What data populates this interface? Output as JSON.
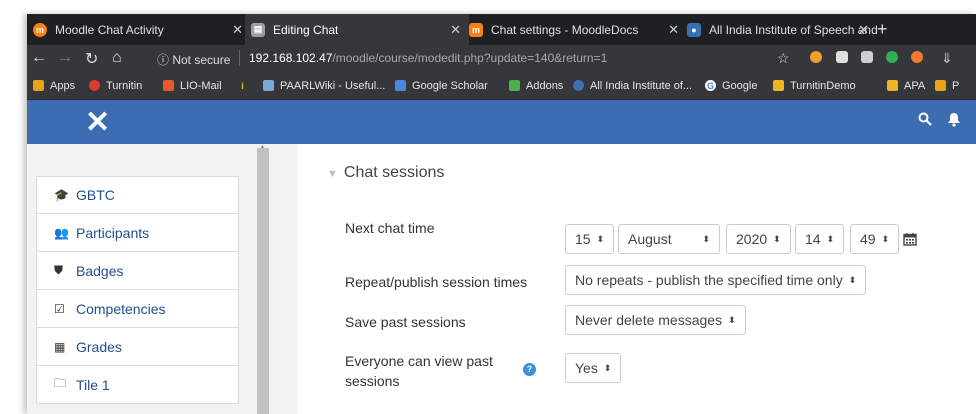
{
  "browser": {
    "tabs": [
      {
        "title": "Moodle Chat Activity",
        "icon": "moodle-icon",
        "color": "#f98012",
        "active": false
      },
      {
        "title": "Editing Chat",
        "icon": "moodle-page-icon",
        "color": "#9e9e9e",
        "active": true
      },
      {
        "title": "Chat settings - MoodleDocs",
        "icon": "moodledocs-icon",
        "color": "#f98012",
        "active": false
      },
      {
        "title": "All India Institute of Speech and",
        "icon": "aiish-icon",
        "color": "#3a6fb0",
        "active": false
      }
    ],
    "security_label": "Not secure",
    "url_host": "192.168.102.47",
    "url_path": "/moodle/course/modedit.php?update=140&return=1",
    "bookmarks": [
      {
        "label": "Apps",
        "icon": "apps-grid-icon",
        "color": "#e8a317"
      },
      {
        "label": "Turnitin",
        "icon": "turnitin-icon",
        "color": "#d83b2f"
      },
      {
        "label": "LIO-Mail",
        "icon": "lio-mail-icon",
        "color": "#e8582f"
      },
      {
        "label": "",
        "icon": "info-icon",
        "color": "#e8c21a"
      },
      {
        "label": "PAARLWiki - Useful...",
        "icon": "paarlwiki-icon",
        "color": "#7aa9d9"
      },
      {
        "label": "Google Scholar",
        "icon": "google-scholar-icon",
        "color": "#4a88e0"
      },
      {
        "label": "Addons",
        "icon": "addons-icon",
        "color": "#4caf50"
      },
      {
        "label": "All India Institute of...",
        "icon": "aiish-icon",
        "color": "#3a6fb0"
      },
      {
        "label": "Google",
        "icon": "google-icon",
        "color": "#ffffff"
      },
      {
        "label": "TurnitinDemo",
        "icon": "folder-icon",
        "color": "#f0b429"
      },
      {
        "label": "APA",
        "icon": "folder-icon",
        "color": "#f0b429"
      },
      {
        "label": "P",
        "icon": "cla-icon",
        "color": "#e8a317"
      }
    ]
  },
  "drawer": {
    "items": [
      {
        "label": "GBTC",
        "icon": "graduation-cap-icon",
        "glyph": "🎓"
      },
      {
        "label": "Participants",
        "icon": "users-icon",
        "glyph": "👥"
      },
      {
        "label": "Badges",
        "icon": "shield-icon",
        "glyph": "⛊"
      },
      {
        "label": "Competencies",
        "icon": "check-square-icon",
        "glyph": "☑"
      },
      {
        "label": "Grades",
        "icon": "table-icon",
        "glyph": "▦"
      },
      {
        "label": "Tile 1",
        "icon": "folder-icon",
        "glyph": "🗀"
      }
    ]
  },
  "form": {
    "section_title": "Chat sessions",
    "next_chat_time_label": "Next chat time",
    "day": "15",
    "month": "August",
    "year": "2020",
    "hour": "14",
    "minute": "49",
    "repeat_label": "Repeat/publish session times",
    "repeat_value": "No repeats - publish the specified time only",
    "save_label": "Save past sessions",
    "save_value": "Never delete messages",
    "view_label_line1": "Everyone can view past",
    "view_label_line2": "sessions",
    "view_value": "Yes"
  }
}
